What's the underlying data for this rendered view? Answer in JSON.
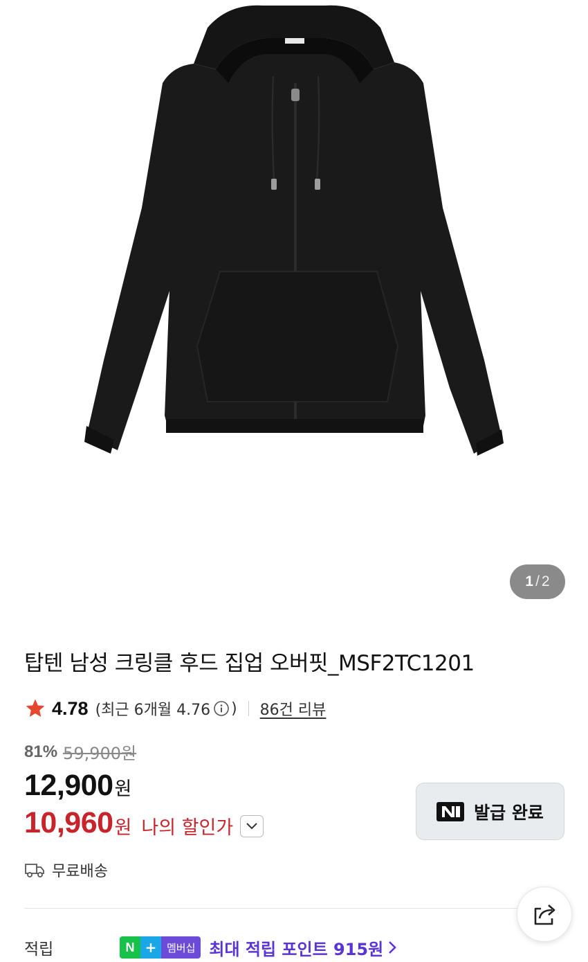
{
  "gallery": {
    "current": "1",
    "separator": "/",
    "total": "2",
    "image_alt_icon": "hood-zip-up-product-image"
  },
  "product": {
    "title": "탑텐 남성 크링클 후드 집업 오버핏_MSF2TC1201"
  },
  "rating": {
    "star_icon": "star-icon",
    "star_color": "#e8472f",
    "value": "4.78",
    "recent_prefix": "(최근 6개월 4.76",
    "recent_suffix": ")",
    "info_icon": "info-icon",
    "reviews_link": "86건 리뷰"
  },
  "pricing": {
    "discount_percent": "81%",
    "original_price": "59,900원",
    "sale_price": "12,900",
    "sale_unit": "원",
    "my_price": "10,960",
    "my_unit": "원",
    "my_price_label": "나의 할인가",
    "my_price_color": "#c8242b",
    "expand_icon": "chevron-down-icon"
  },
  "coupon": {
    "brand_icon": "naver-n-icon",
    "label": "발급 완료"
  },
  "shipping": {
    "icon": "truck-icon",
    "label": "무료배송"
  },
  "share": {
    "icon": "share-icon"
  },
  "points": {
    "label": "적립",
    "badge_n": "N",
    "badge_plus": "+",
    "badge_membership": "멤버십",
    "text": "최대 적립 포인트 915원",
    "chevron_icon": "chevron-right-icon",
    "accent": "#5b34d6"
  }
}
